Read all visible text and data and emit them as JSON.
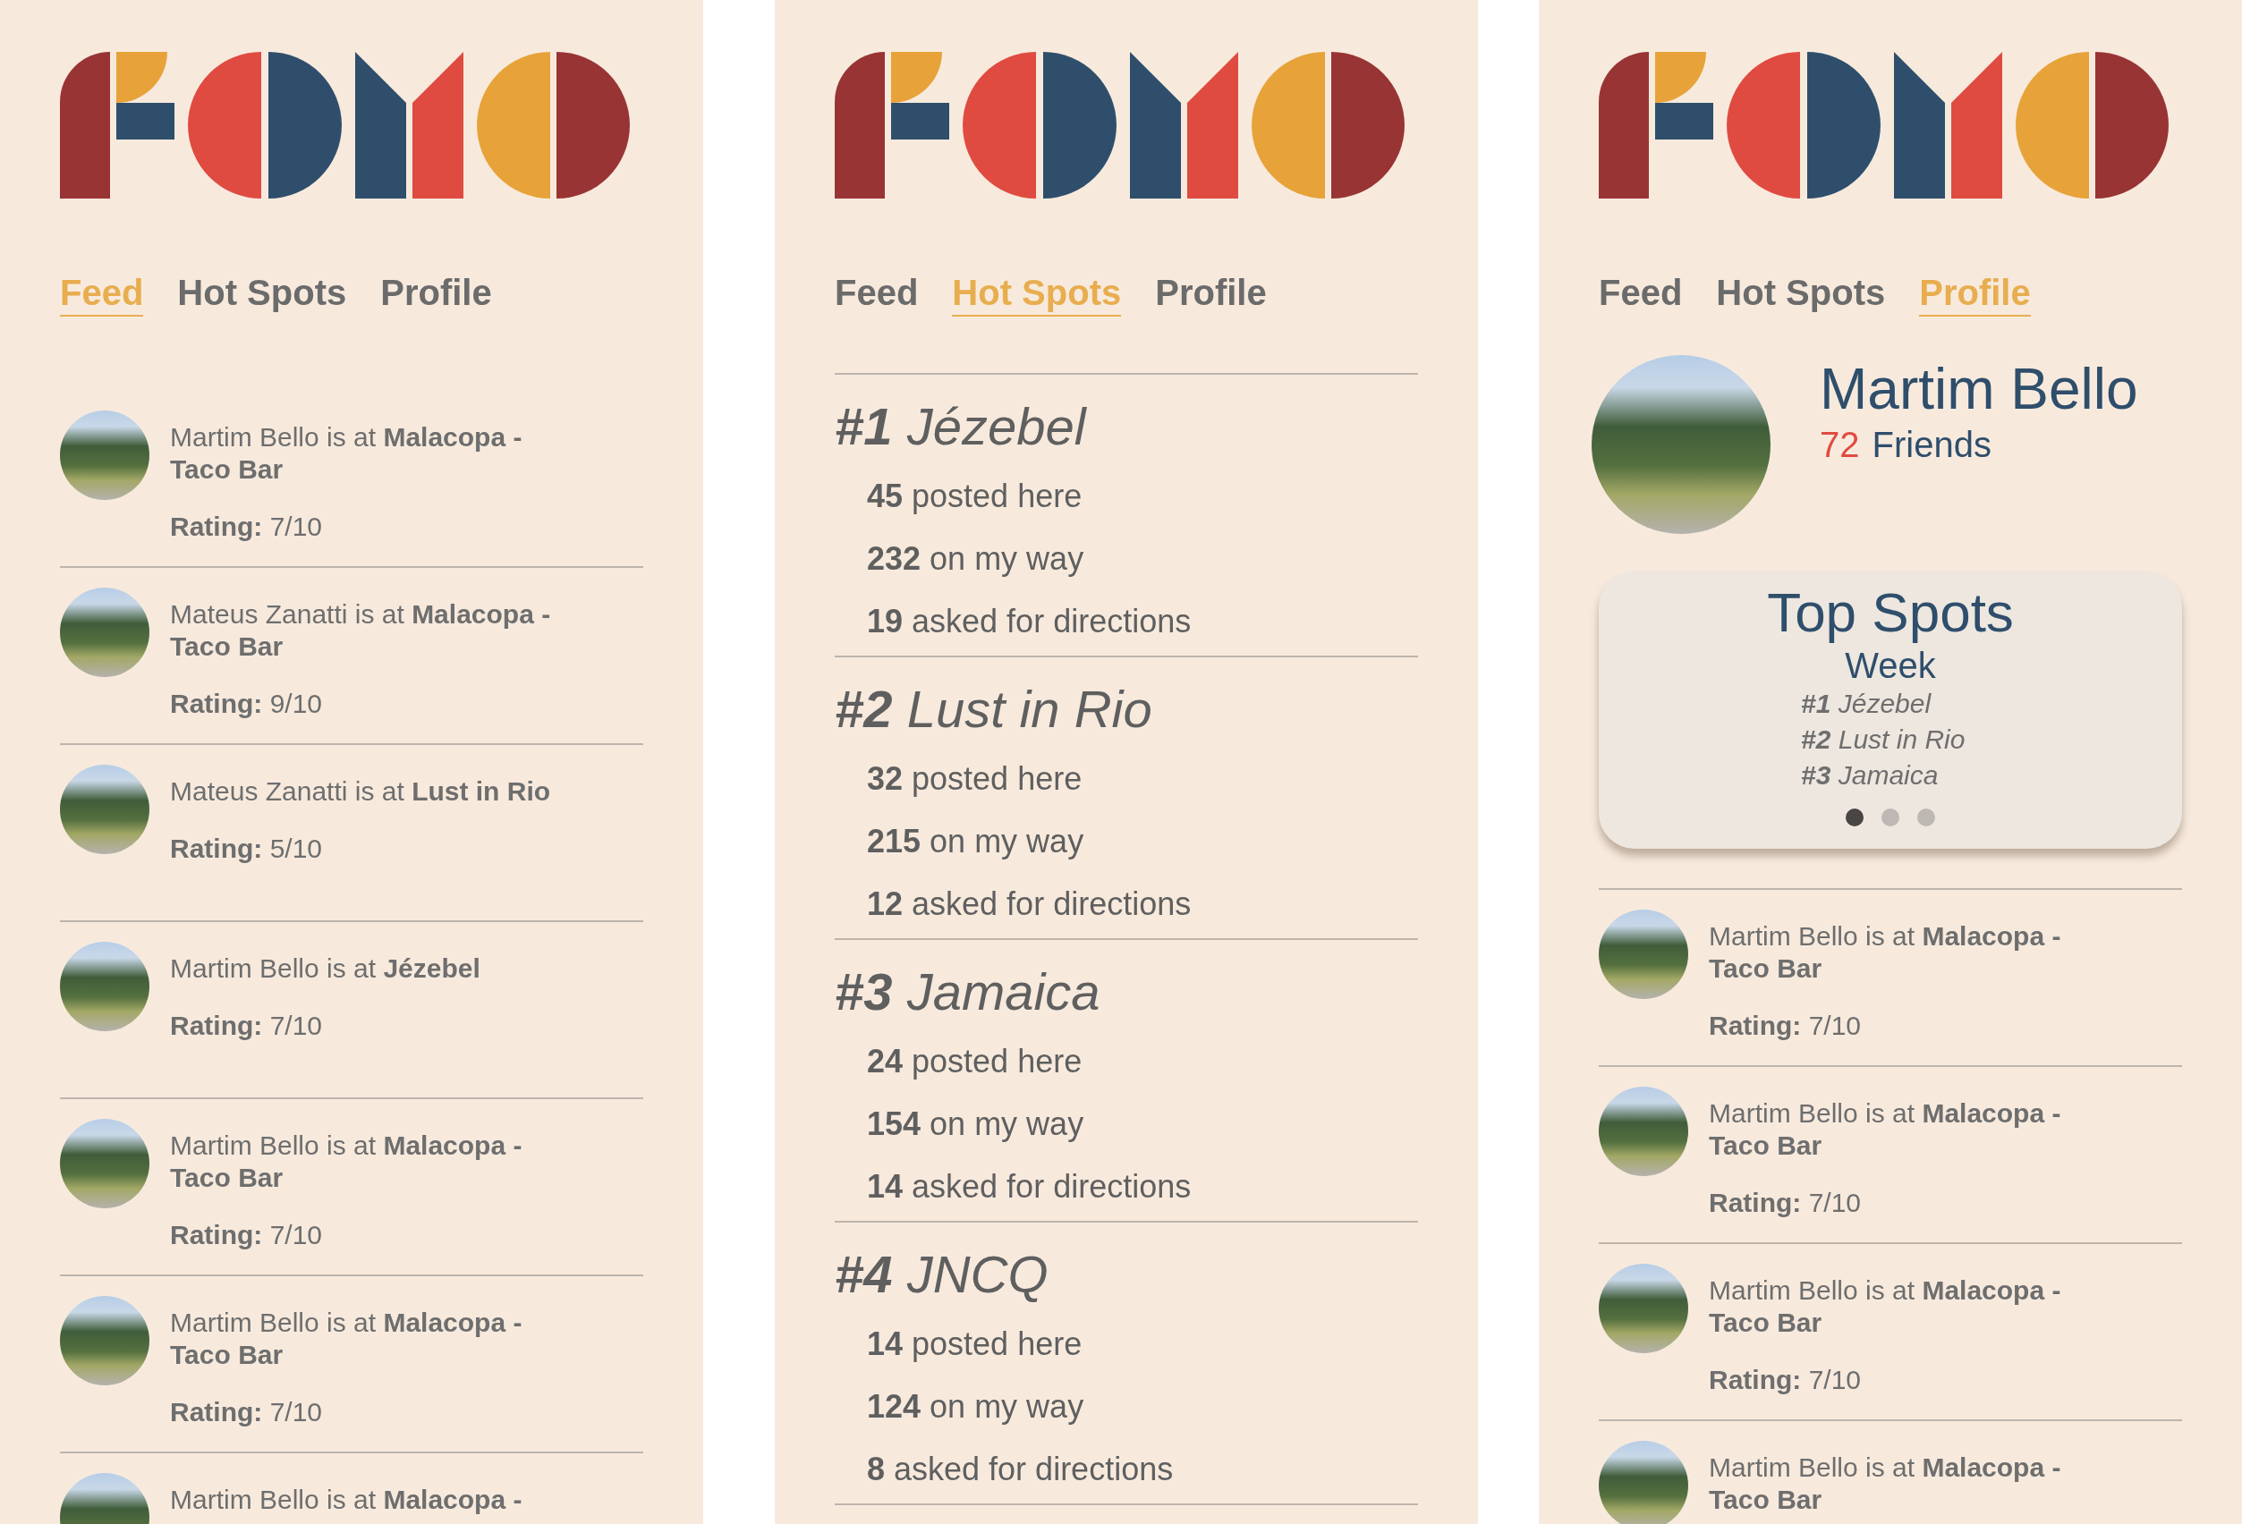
{
  "screens": [
    {
      "kind": "feed",
      "tabs": [
        {
          "label": "Feed",
          "selected": true
        },
        {
          "label": "Hot Spots",
          "selected": false
        },
        {
          "label": "Profile",
          "selected": false
        }
      ],
      "feed": [
        {
          "text": "Martim Bello is at **Malacopa - Taco Bar**",
          "rating": "**Rating:** 7/10"
        },
        {
          "text": "Mateus Zanatti is at **Malacopa - Taco Bar**",
          "rating": "**Rating:** 9/10"
        },
        {
          "text": "Mateus Zanatti is at **Lust in Rio**",
          "rating": "**Rating:** 5/10"
        },
        {
          "text": "Martim Bello is at **Jézebel**",
          "rating": "**Rating:** 7/10"
        },
        {
          "text": "Martim Bello is at **Malacopa - Taco Bar**",
          "rating": "**Rating:** 7/10"
        },
        {
          "text": "Martim Bello is at **Malacopa - Taco Bar**",
          "rating": "**Rating:** 7/10"
        },
        {
          "text": "Martim Bello is at **Malacopa -**"
        }
      ]
    },
    {
      "kind": "hotspots",
      "tabs": [
        {
          "label": "Feed",
          "selected": false
        },
        {
          "label": "Hot Spots",
          "selected": true
        },
        {
          "label": "Profile",
          "selected": false
        }
      ],
      "spots": [
        {
          "rank": "#1",
          "name": "Jézebel",
          "stats": [
            "**45** posted here",
            "**232** on my way",
            "**19** asked for directions"
          ]
        },
        {
          "rank": "#2",
          "name": "Lust in Rio",
          "stats": [
            "**32** posted here",
            "**215** on my way",
            "**12** asked for directions"
          ]
        },
        {
          "rank": "#3",
          "name": "Jamaica",
          "stats": [
            "**24** posted here",
            "**154** on my way",
            "**14** asked for directions"
          ]
        },
        {
          "rank": "#4",
          "name": "JNCQ",
          "stats": [
            "**14** posted here",
            "**124** on my way",
            "**8** asked for directions"
          ]
        }
      ]
    },
    {
      "kind": "profile",
      "tabs": [
        {
          "label": "Feed",
          "selected": false
        },
        {
          "label": "Hot Spots",
          "selected": false
        },
        {
          "label": "Profile",
          "selected": true
        }
      ],
      "profile": {
        "name": "Martim Bello",
        "friends_count": "72",
        "friends_label": "Friends"
      },
      "top_spots": {
        "title": "Top Spots",
        "period": "Week",
        "items": [
          {
            "rank": "#1",
            "name": "Jézebel"
          },
          {
            "rank": "#2",
            "name": "Lust in Rio"
          },
          {
            "rank": "#3",
            "name": "Jamaica"
          }
        ],
        "pages": [
          {
            "selected": true
          },
          {
            "selected": false
          },
          {
            "selected": false
          }
        ]
      },
      "feed": [
        {
          "text": "Martim Bello is at **Malacopa - Taco Bar**",
          "rating": "**Rating:** 7/10"
        },
        {
          "text": "Martim Bello is at **Malacopa - Taco Bar**",
          "rating": "**Rating:** 7/10"
        },
        {
          "text": "Martim Bello is at **Malacopa - Taco Bar**",
          "rating": "**Rating:** 7/10"
        },
        {
          "text": "Martim Bello is at **Malacopa - Taco Bar**"
        }
      ]
    }
  ]
}
